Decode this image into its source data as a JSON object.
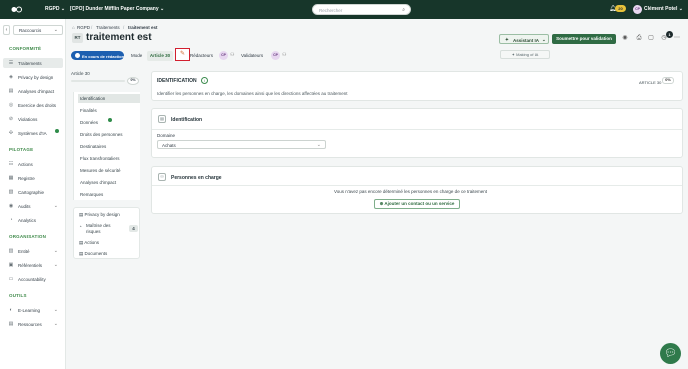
{
  "topbar": {
    "workspace": "RGPD",
    "company": "[CPO] Dunder Mifflin Paper Company",
    "search_placeholder": "Rechercher",
    "notif_count": "20",
    "user_initials": "CP",
    "user_name": "Clément Potel"
  },
  "sidebar": {
    "shortcut_label": "Raccourcis",
    "sections": {
      "conformite": "CONFORMITÉ",
      "pilotage": "PILOTAGE",
      "organisation": "ORGANISATION",
      "outils": "OUTILS"
    },
    "items": {
      "traitements": "Traitements",
      "privacy_by_design": "Privacy by design",
      "analyses_impact": "Analyses d'impact",
      "exercice_droits": "Exercice des droits",
      "violations": "Violations",
      "systemes_ia": "Systèmes d'IA",
      "actions": "Actions",
      "registre": "Registre",
      "cartographie": "Cartographie",
      "audits": "Audits",
      "analytics": "Analytics",
      "entite": "Entité",
      "referentiels": "Référentiels",
      "accountability": "Accountability",
      "e_learning": "E-Learning",
      "ressources": "Ressources"
    }
  },
  "breadcrumb": {
    "root": "RGPD",
    "section": "Traitements",
    "current": "traitement est"
  },
  "header": {
    "badge": "RT",
    "title": "traitement est",
    "assist_label": "Assistant IA",
    "submit_label": "Soumettre pour validation",
    "help_count": "1"
  },
  "subheader": {
    "status": "En cours de rédaction",
    "mode_label": "Mode",
    "mode_value": "Article 30",
    "redacteurs_label": "Rédacteurs",
    "redacteur_initials": "CP",
    "validateurs_label": "Validateurs",
    "validateur_initials": "CP",
    "making_of": "Making of IA"
  },
  "left_panel": {
    "title": "Article 30",
    "progress_label": "0%",
    "progress_fraction": 0,
    "steps": [
      "Identification",
      "Finalités",
      "Données",
      "Droits des personnes",
      "Destinataires",
      "Flux transfrontaliers",
      "Mesures de sécurité",
      "Analyses d'impact",
      "Remarques"
    ],
    "links": {
      "privacy": "Privacy by design",
      "risques": "Maîtrise des risques",
      "risques_count": "4",
      "actions": "Actions",
      "documents": "Documents"
    }
  },
  "identification_card": {
    "title": "IDENTIFICATION",
    "article_label": "ARTICLE 30",
    "pct": "0%",
    "description": "Identifier les personnes en charge, les domaines ainsi que les directions affectées au traitement"
  },
  "identification_section": {
    "title": "Identification",
    "domaine_label": "Domaine",
    "domaine_value": "Achats"
  },
  "en_charge_section": {
    "title": "Personnes en charge",
    "empty_text": "Vous n'avez pas encore déterminé les personnes en charge de ce traitement",
    "add_button": "Ajouter un contact ou un service"
  }
}
